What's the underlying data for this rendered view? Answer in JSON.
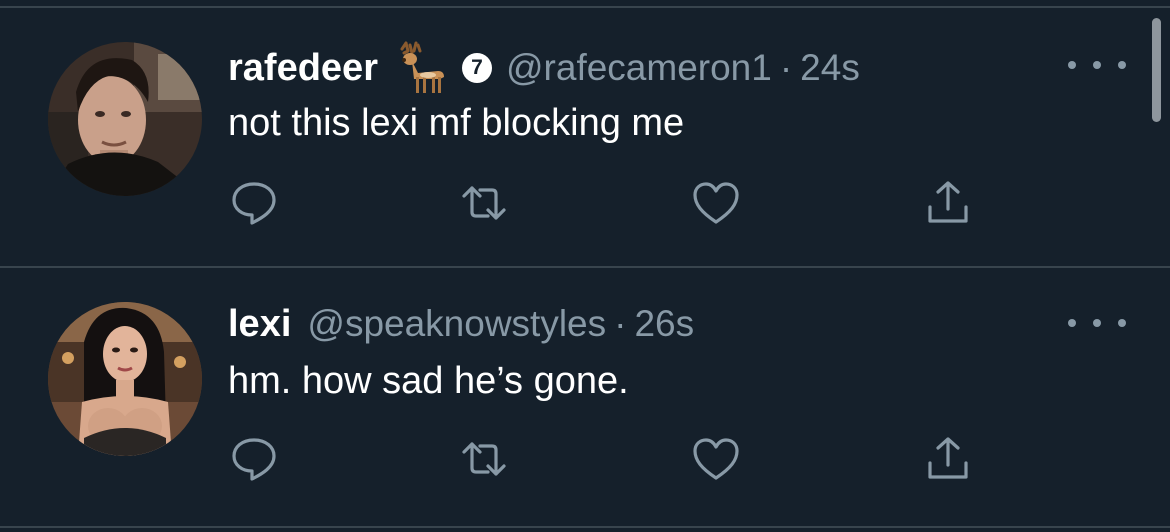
{
  "tweets": [
    {
      "display_name": "rafedeer",
      "name_emoji": "deer-emoji",
      "badge": "7",
      "handle": "@rafecameron1",
      "separator": "·",
      "time": "24s",
      "text": "not this lexi mf blocking me",
      "avatar": "profile-photo-man"
    },
    {
      "display_name": "lexi",
      "handle": "@speaknowstyles",
      "separator": "·",
      "time": "26s",
      "text": "hm. how sad he’s gone.",
      "avatar": "profile-photo-woman"
    }
  ],
  "actions": [
    "reply-icon",
    "retweet-icon",
    "like-icon",
    "share-icon"
  ],
  "more_icon": "more-horizontal-icon",
  "colors": {
    "background": "#15202b",
    "divider": "#38444d",
    "primary_text": "#ffffff",
    "secondary_text": "#8899a6"
  }
}
